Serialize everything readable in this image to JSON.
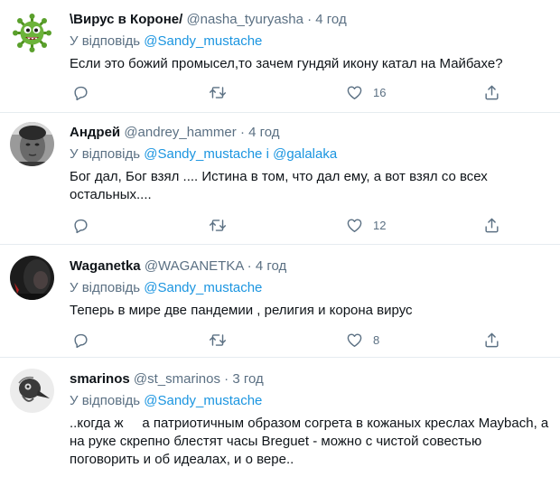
{
  "tweets": [
    {
      "name": "\\Вирус в Короне/",
      "handle": "@nasha_tyuryasha",
      "dot": "·",
      "time": "4 год",
      "reply_prefix": "У відповідь",
      "mention1": "@Sandy_mustache",
      "mention_join": "",
      "mention2": "",
      "text": "Если это божий промысел,то зачем гундяй икону катал на Майбахе?",
      "reply_count": "",
      "retweet_count": "",
      "like_count": "16"
    },
    {
      "name": "Андрей",
      "handle": "@andrey_hammer",
      "dot": "·",
      "time": "4 год",
      "reply_prefix": "У відповідь",
      "mention1": "@Sandy_mustache",
      "mention_join": "і",
      "mention2": "@galalaka",
      "text": "Бог дал, Бог взял .... Истина в том, что дал ему, а вот взял со всех остальных....",
      "reply_count": "",
      "retweet_count": "",
      "like_count": "12"
    },
    {
      "name": "Waganetka",
      "handle": "@WAGANETKA",
      "dot": "·",
      "time": "4 год",
      "reply_prefix": "У відповідь",
      "mention1": "@Sandy_mustache",
      "mention_join": "",
      "mention2": "",
      "text": "Теперь в мире две пандемии , религия и корона вирус",
      "reply_count": "",
      "retweet_count": "",
      "like_count": "8"
    },
    {
      "name": "smarinos",
      "handle": "@st_smarinos",
      "dot": "·",
      "time": "3 год",
      "reply_prefix": "У відповідь",
      "mention1": "@Sandy_mustache",
      "mention_join": "",
      "mention2": "",
      "text": "..когда ж     а патриотичным образом согрета в кожаных креслах Maybach, а на руке скрепно блестят часы Breguet - можно с чистой совестью поговорить и об идеалах, и о вере..",
      "reply_count": "",
      "retweet_count": "",
      "like_count": ""
    }
  ],
  "icons": {
    "reply": "reply-icon",
    "retweet": "retweet-icon",
    "like": "heart-icon",
    "share": "share-icon"
  },
  "colors": {
    "text": "#0f1419",
    "secondary": "#5b7083",
    "link": "#1b95e0",
    "divider": "#e6ecf0"
  }
}
